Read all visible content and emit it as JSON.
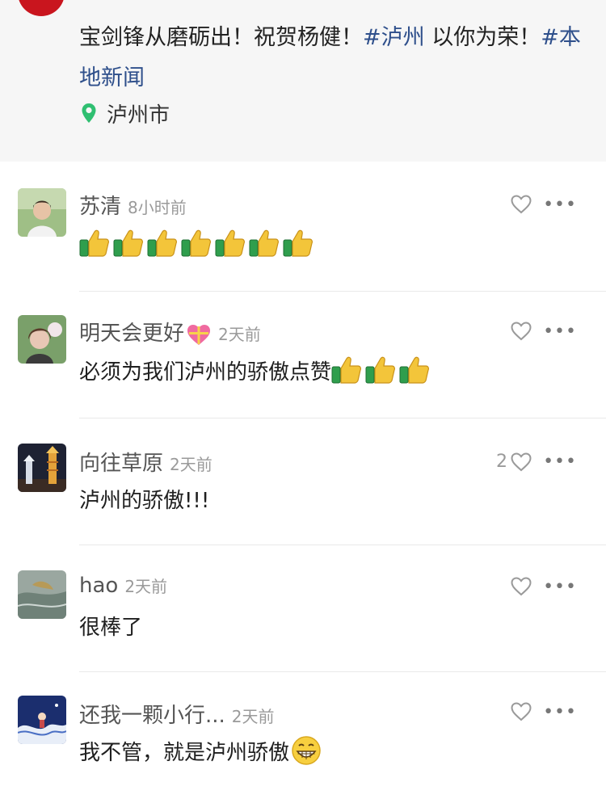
{
  "post": {
    "text_parts": [
      {
        "text": "宝剑锋从磨砺出！祝贺杨健！",
        "hashtag": false
      },
      {
        "text": "#泸州",
        "hashtag": true
      },
      {
        "text": " 以你为荣！",
        "hashtag": false
      },
      {
        "text": "#本地新闻",
        "hashtag": true
      }
    ],
    "location": "泸州市"
  },
  "comments": [
    {
      "name": "苏清",
      "time": "8小时前",
      "text": "",
      "like_count": "",
      "emoji_thumbs": 7
    },
    {
      "name": "明天会更好",
      "time": "2天前",
      "text": "必须为我们泸州的骄傲点赞",
      "like_count": "",
      "emoji_thumbs": 3
    },
    {
      "name": "向往草原",
      "time": "2天前",
      "text": "泸州的骄傲!!!",
      "like_count": "2",
      "emoji_thumbs": 0
    },
    {
      "name": "hao",
      "time": "2天前",
      "text": "很棒了",
      "like_count": "",
      "emoji_thumbs": 0
    },
    {
      "name": "还我一颗小行...",
      "time": "2天前",
      "text": "我不管，就是泸州骄傲",
      "like_count": "",
      "emoji_thumbs": 0
    }
  ],
  "icons": {
    "location": "location-pin-icon",
    "like": "heart-outline-icon",
    "more": "more-dots-icon"
  },
  "colors": {
    "hashtag": "#2e4f8b",
    "location_pin": "#2fbf71",
    "post_background": "#f6f6f6"
  }
}
